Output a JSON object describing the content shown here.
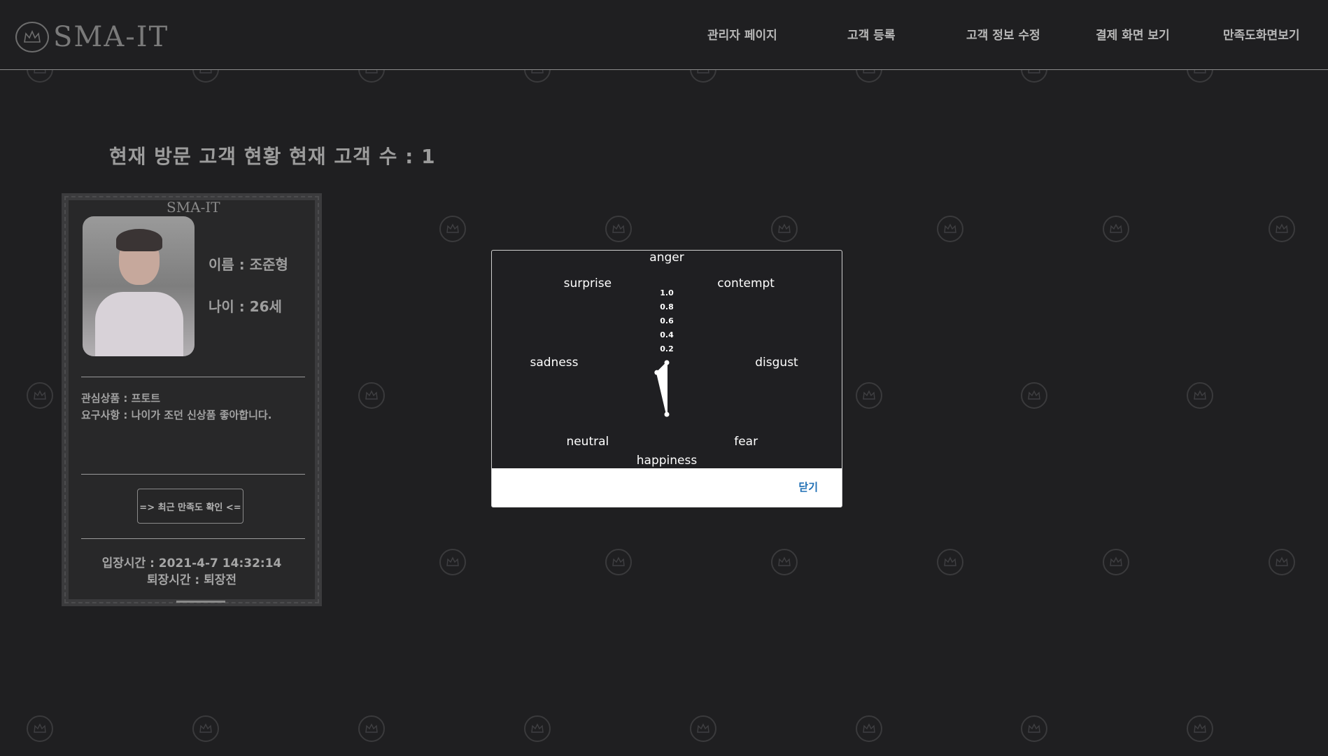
{
  "header": {
    "logo_text": "SMA-IT",
    "nav": [
      {
        "label": "관리자 페이지"
      },
      {
        "label": "고객 등록"
      },
      {
        "label": "고객 정보 수정"
      },
      {
        "label": "결제 화면 보기"
      },
      {
        "label": "만족도화면보기"
      }
    ]
  },
  "main": {
    "title": "현재 방문 고객 현황 현재 고객 수 : 1"
  },
  "card": {
    "logo_text": "SMA-IT",
    "name": "이름 : 조준형",
    "age": "나이 : 26세",
    "interest": "관심상품 : 프토트",
    "request": "요구사항 : 나이가 조던 신상품 좋아합니다.",
    "satisfaction_button": "=> 최근 만족도 확인 <=",
    "entry_time": "입장시간 : 2021-4-7 14:32:14",
    "exit_time": "퇴장시간 : 퇴장전"
  },
  "modal": {
    "close_label": "닫기"
  },
  "chart_data": {
    "type": "radar",
    "axes": [
      "anger",
      "contempt",
      "disgust",
      "fear",
      "happiness",
      "neutral",
      "sadness",
      "surprise"
    ],
    "values": [
      0.0,
      0.0,
      0.0,
      0.0,
      0.74,
      0.2,
      0.0,
      0.0
    ],
    "rlim": [
      0,
      1.0
    ],
    "ticks": [
      "0.2",
      "0.4",
      "0.6",
      "0.8",
      "1.0"
    ],
    "colors": {
      "fill": "#ffffff",
      "background": "#1f1f22",
      "text": "#ffffff"
    }
  }
}
